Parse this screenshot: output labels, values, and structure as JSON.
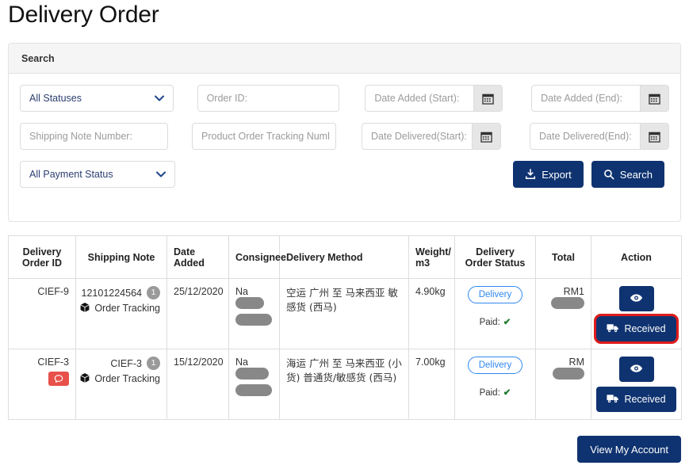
{
  "page": {
    "title": "Delivery Order"
  },
  "search_panel": {
    "heading": "Search",
    "status_select": {
      "value": "All Statuses"
    },
    "order_id": {
      "placeholder": "Order ID:"
    },
    "date_added_start": {
      "placeholder": "Date Added (Start):"
    },
    "date_added_end": {
      "placeholder": "Date Added (End):"
    },
    "shipping_note_number": {
      "placeholder": "Shipping Note Number:"
    },
    "product_order_tracking": {
      "placeholder": "Product Order Tracking Numl"
    },
    "date_delivered_start": {
      "placeholder": "Date Delivered(Start):"
    },
    "date_delivered_end": {
      "placeholder": "Date Delivered(End):"
    },
    "payment_select": {
      "value": "All Payment Status"
    },
    "export_label": "Export",
    "search_label": "Search",
    "icons": {
      "calendar": "calendar-icon",
      "export": "download-icon",
      "search": "magnifier-icon",
      "chevron": "chevron-down-icon"
    }
  },
  "table": {
    "columns": [
      "Delivery Order ID",
      "Shipping Note",
      "Date Added",
      "Consignee",
      "Delivery Method",
      "Weight/ m3",
      "Delivery Order Status",
      "Total",
      "Action"
    ],
    "rows": [
      {
        "delivery_order_id": "CIEF-9",
        "has_comment_badge": false,
        "shipping_note": "12101224564",
        "shipping_note_count": "1",
        "tracking_label": "Order Tracking",
        "date_added": "25/12/2020",
        "consignee": "Na",
        "delivery_method": "空运 广州 至 马来西亚 敏感货 (西马)",
        "weight": "4.90kg",
        "status": "Delivery",
        "paid_label": "Paid:",
        "paid_check": "✔",
        "total_prefix": "RM1",
        "view_label": "",
        "received_label": "Received",
        "received_highlighted": true
      },
      {
        "delivery_order_id": "CIEF-3",
        "has_comment_badge": true,
        "shipping_note": "CIEF-3",
        "shipping_note_count": "1",
        "tracking_label": "Order Tracking",
        "date_added": "15/12/2020",
        "consignee": "Na",
        "delivery_method": "海运 广州 至 马来西亚 (小货) 普通货/敏感货 (西马)",
        "weight": "7.00kg",
        "status": "Delivery",
        "paid_label": "Paid:",
        "paid_check": "✔",
        "total_prefix": "RM",
        "view_label": "",
        "received_label": "Received",
        "received_highlighted": false
      }
    ]
  },
  "footer": {
    "account_button": "View My Account"
  },
  "colors": {
    "primary": "#0f3370",
    "accent_blue": "#2f88ef",
    "danger": "#e8504a",
    "highlight": "#e01b1b",
    "paid_green": "#1d7a2e",
    "redact_gray": "#888888"
  }
}
